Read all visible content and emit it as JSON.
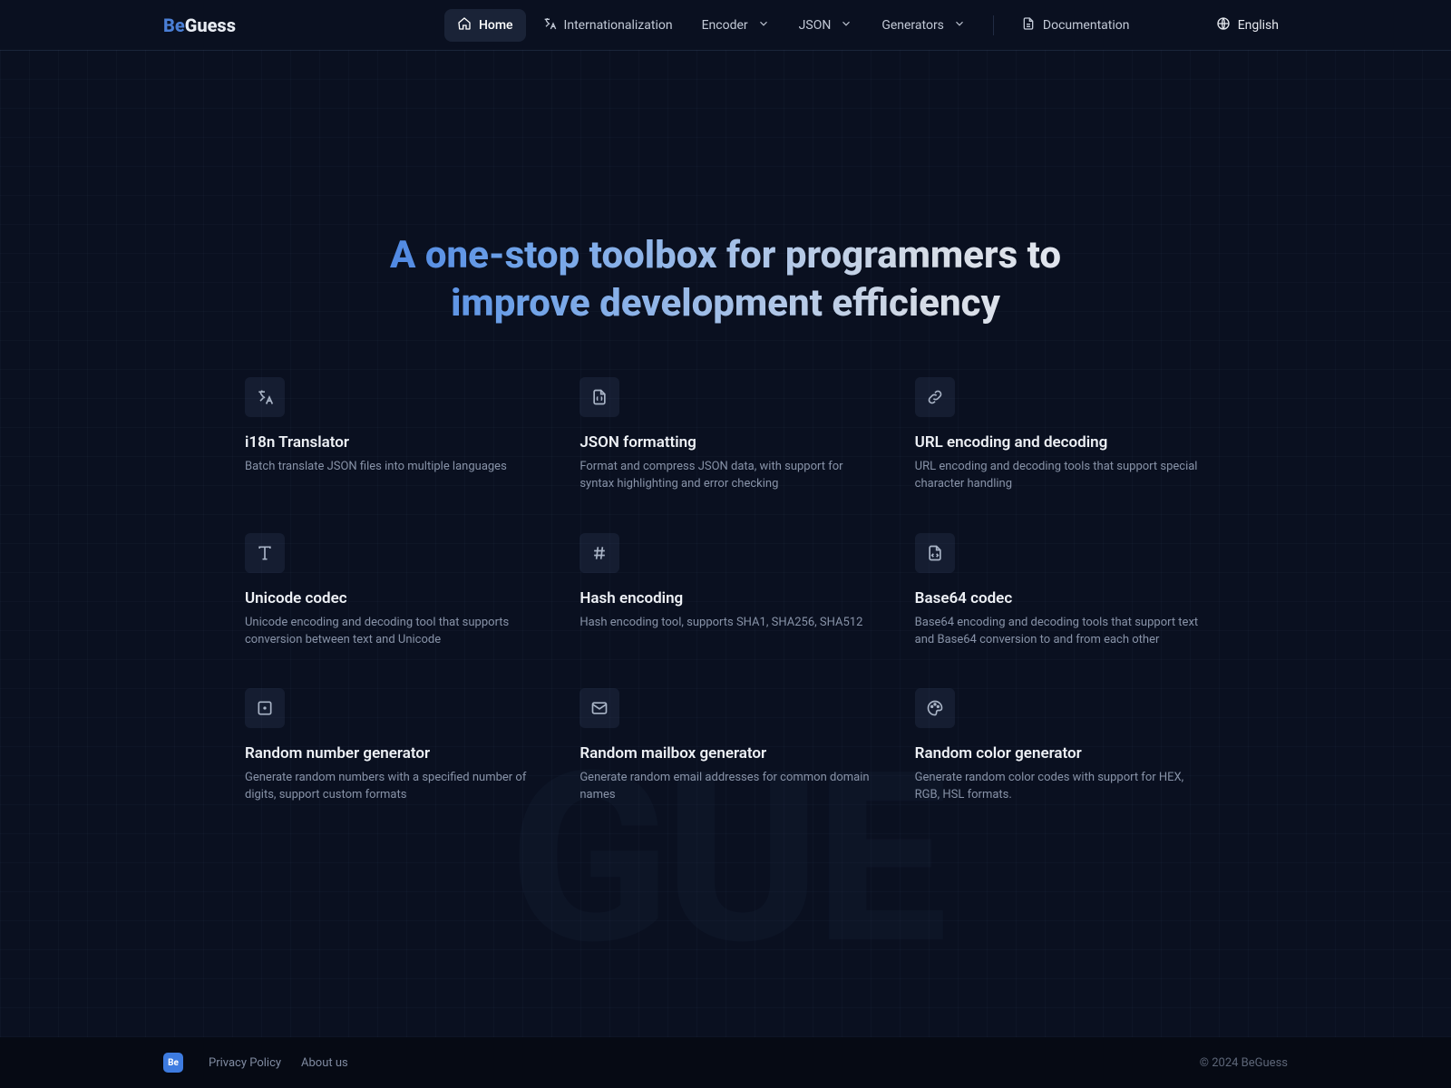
{
  "brand": {
    "be": "Be",
    "guess": "Guess",
    "footer_badge": "Be"
  },
  "nav": {
    "home": "Home",
    "i18n": "Internationalization",
    "encoder": "Encoder",
    "json": "JSON",
    "generators": "Generators",
    "docs": "Documentation"
  },
  "lang": {
    "label": "English"
  },
  "hero": {
    "title": "A one-stop toolbox for programmers to improve development efficiency"
  },
  "tools": [
    {
      "title": "i18n Translator",
      "desc": "Batch translate JSON files into multiple languages"
    },
    {
      "title": "JSON formatting",
      "desc": "Format and compress JSON data, with support for syntax highlighting and error checking"
    },
    {
      "title": "URL encoding and decoding",
      "desc": "URL encoding and decoding tools that support special character handling"
    },
    {
      "title": "Unicode codec",
      "desc": "Unicode encoding and decoding tool that supports conversion between text and Unicode"
    },
    {
      "title": "Hash encoding",
      "desc": "Hash encoding tool, supports SHA1, SHA256, SHA512"
    },
    {
      "title": "Base64 codec",
      "desc": "Base64 encoding and decoding tools that support text and Base64 conversion to and from each other"
    },
    {
      "title": "Random number generator",
      "desc": "Generate random numbers with a specified number of digits, support custom formats"
    },
    {
      "title": "Random mailbox generator",
      "desc": "Generate random email addresses for common domain names"
    },
    {
      "title": "Random color generator",
      "desc": "Generate random color codes with support for HEX, RGB, HSL formats."
    }
  ],
  "footer": {
    "privacy": "Privacy Policy",
    "about": "About us",
    "copyright": "© 2024 BeGuess"
  },
  "watermark": "GUE"
}
